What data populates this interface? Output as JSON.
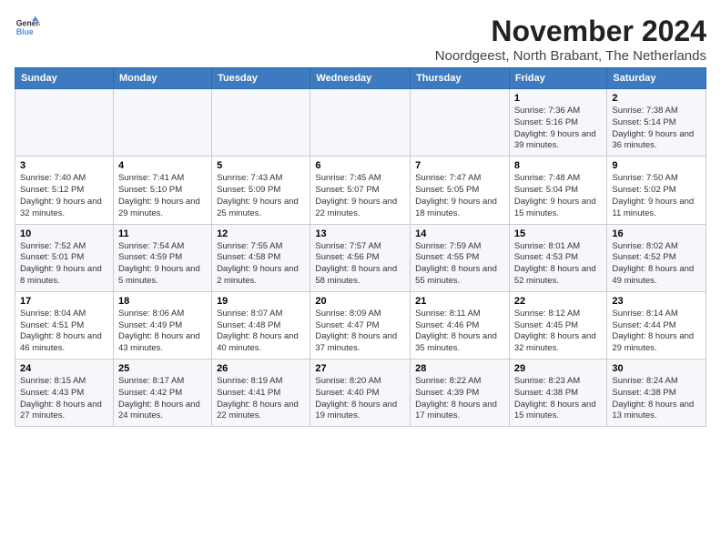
{
  "header": {
    "logo_line1": "General",
    "logo_line2": "Blue",
    "month_title": "November 2024",
    "subtitle": "Noordgeest, North Brabant, The Netherlands"
  },
  "weekdays": [
    "Sunday",
    "Monday",
    "Tuesday",
    "Wednesday",
    "Thursday",
    "Friday",
    "Saturday"
  ],
  "weeks": [
    [
      {
        "day": "",
        "info": ""
      },
      {
        "day": "",
        "info": ""
      },
      {
        "day": "",
        "info": ""
      },
      {
        "day": "",
        "info": ""
      },
      {
        "day": "",
        "info": ""
      },
      {
        "day": "1",
        "info": "Sunrise: 7:36 AM\nSunset: 5:16 PM\nDaylight: 9 hours and 39 minutes."
      },
      {
        "day": "2",
        "info": "Sunrise: 7:38 AM\nSunset: 5:14 PM\nDaylight: 9 hours and 36 minutes."
      }
    ],
    [
      {
        "day": "3",
        "info": "Sunrise: 7:40 AM\nSunset: 5:12 PM\nDaylight: 9 hours and 32 minutes."
      },
      {
        "day": "4",
        "info": "Sunrise: 7:41 AM\nSunset: 5:10 PM\nDaylight: 9 hours and 29 minutes."
      },
      {
        "day": "5",
        "info": "Sunrise: 7:43 AM\nSunset: 5:09 PM\nDaylight: 9 hours and 25 minutes."
      },
      {
        "day": "6",
        "info": "Sunrise: 7:45 AM\nSunset: 5:07 PM\nDaylight: 9 hours and 22 minutes."
      },
      {
        "day": "7",
        "info": "Sunrise: 7:47 AM\nSunset: 5:05 PM\nDaylight: 9 hours and 18 minutes."
      },
      {
        "day": "8",
        "info": "Sunrise: 7:48 AM\nSunset: 5:04 PM\nDaylight: 9 hours and 15 minutes."
      },
      {
        "day": "9",
        "info": "Sunrise: 7:50 AM\nSunset: 5:02 PM\nDaylight: 9 hours and 11 minutes."
      }
    ],
    [
      {
        "day": "10",
        "info": "Sunrise: 7:52 AM\nSunset: 5:01 PM\nDaylight: 9 hours and 8 minutes."
      },
      {
        "day": "11",
        "info": "Sunrise: 7:54 AM\nSunset: 4:59 PM\nDaylight: 9 hours and 5 minutes."
      },
      {
        "day": "12",
        "info": "Sunrise: 7:55 AM\nSunset: 4:58 PM\nDaylight: 9 hours and 2 minutes."
      },
      {
        "day": "13",
        "info": "Sunrise: 7:57 AM\nSunset: 4:56 PM\nDaylight: 8 hours and 58 minutes."
      },
      {
        "day": "14",
        "info": "Sunrise: 7:59 AM\nSunset: 4:55 PM\nDaylight: 8 hours and 55 minutes."
      },
      {
        "day": "15",
        "info": "Sunrise: 8:01 AM\nSunset: 4:53 PM\nDaylight: 8 hours and 52 minutes."
      },
      {
        "day": "16",
        "info": "Sunrise: 8:02 AM\nSunset: 4:52 PM\nDaylight: 8 hours and 49 minutes."
      }
    ],
    [
      {
        "day": "17",
        "info": "Sunrise: 8:04 AM\nSunset: 4:51 PM\nDaylight: 8 hours and 46 minutes."
      },
      {
        "day": "18",
        "info": "Sunrise: 8:06 AM\nSunset: 4:49 PM\nDaylight: 8 hours and 43 minutes."
      },
      {
        "day": "19",
        "info": "Sunrise: 8:07 AM\nSunset: 4:48 PM\nDaylight: 8 hours and 40 minutes."
      },
      {
        "day": "20",
        "info": "Sunrise: 8:09 AM\nSunset: 4:47 PM\nDaylight: 8 hours and 37 minutes."
      },
      {
        "day": "21",
        "info": "Sunrise: 8:11 AM\nSunset: 4:46 PM\nDaylight: 8 hours and 35 minutes."
      },
      {
        "day": "22",
        "info": "Sunrise: 8:12 AM\nSunset: 4:45 PM\nDaylight: 8 hours and 32 minutes."
      },
      {
        "day": "23",
        "info": "Sunrise: 8:14 AM\nSunset: 4:44 PM\nDaylight: 8 hours and 29 minutes."
      }
    ],
    [
      {
        "day": "24",
        "info": "Sunrise: 8:15 AM\nSunset: 4:43 PM\nDaylight: 8 hours and 27 minutes."
      },
      {
        "day": "25",
        "info": "Sunrise: 8:17 AM\nSunset: 4:42 PM\nDaylight: 8 hours and 24 minutes."
      },
      {
        "day": "26",
        "info": "Sunrise: 8:19 AM\nSunset: 4:41 PM\nDaylight: 8 hours and 22 minutes."
      },
      {
        "day": "27",
        "info": "Sunrise: 8:20 AM\nSunset: 4:40 PM\nDaylight: 8 hours and 19 minutes."
      },
      {
        "day": "28",
        "info": "Sunrise: 8:22 AM\nSunset: 4:39 PM\nDaylight: 8 hours and 17 minutes."
      },
      {
        "day": "29",
        "info": "Sunrise: 8:23 AM\nSunset: 4:38 PM\nDaylight: 8 hours and 15 minutes."
      },
      {
        "day": "30",
        "info": "Sunrise: 8:24 AM\nSunset: 4:38 PM\nDaylight: 8 hours and 13 minutes."
      }
    ]
  ]
}
